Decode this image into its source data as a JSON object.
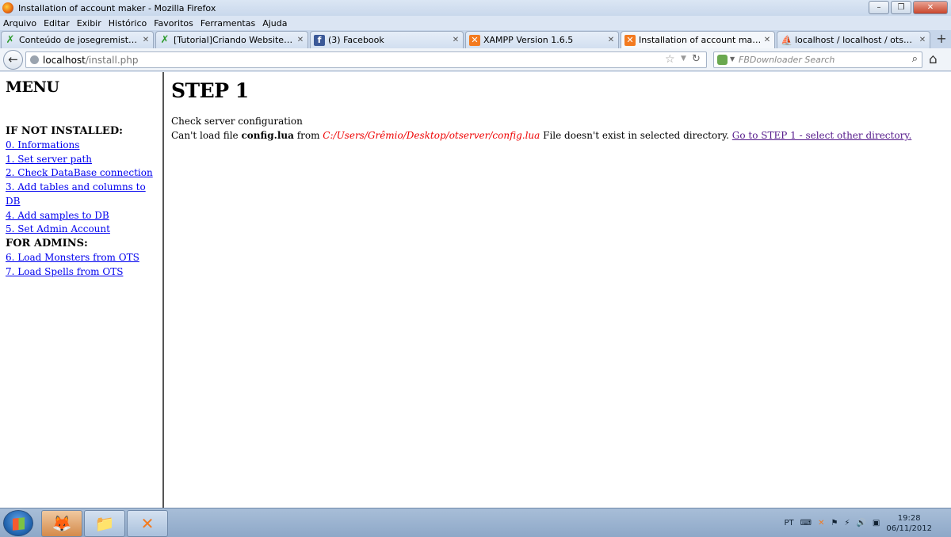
{
  "window": {
    "title": "Installation of account maker - Mozilla Firefox",
    "minimize": "–",
    "maximize": "❐",
    "close": "✕"
  },
  "menubar": [
    "Arquivo",
    "Editar",
    "Exibir",
    "Histórico",
    "Favoritos",
    "Ferramentas",
    "Ajuda"
  ],
  "tabs": [
    {
      "label": "Conteúdo de josegremista - XTi...",
      "favicon": "xti-icon",
      "active": false
    },
    {
      "label": "[Tutorial]Criando Website Com ...",
      "favicon": "xti-icon",
      "active": false
    },
    {
      "label": "(3) Facebook",
      "favicon": "facebook-icon",
      "active": false
    },
    {
      "label": "XAMPP Version 1.6.5",
      "favicon": "xampp-icon",
      "active": false
    },
    {
      "label": "Installation of account maker",
      "favicon": "xampp-icon",
      "active": true
    },
    {
      "label": "localhost / localhost / otserver | ...",
      "favicon": "phpmyadmin-icon",
      "active": false
    }
  ],
  "navbar": {
    "url_host": "localhost",
    "url_path": "/install.php",
    "search_placeholder": "FBDownloader Search"
  },
  "sidebar": {
    "title": "MENU",
    "section_not_installed": "IF NOT INSTALLED:",
    "links_install": [
      "0. Informations",
      "1. Set server path",
      "2. Check DataBase connection",
      "3. Add tables and columns to DB",
      "4. Add samples to DB",
      "5. Set Admin Account"
    ],
    "section_admins": "FOR ADMINS:",
    "links_admin": [
      "6. Load Monsters from OTS",
      "7. Load Spells from OTS"
    ]
  },
  "main": {
    "heading": "STEP 1",
    "line1": "Check server configuration",
    "msg_prefix": "Can't load file ",
    "msg_file": "config.lua",
    "msg_from": " from ",
    "msg_path": "C:/Users/Grêmio/Desktop/otserver/config.lua",
    "msg_suffix": " File doesn't exist in selected directory. ",
    "msg_link": "Go to STEP 1 - select other directory."
  },
  "taskbar": {
    "lang": "PT",
    "time": "19:28",
    "date": "06/11/2012"
  }
}
